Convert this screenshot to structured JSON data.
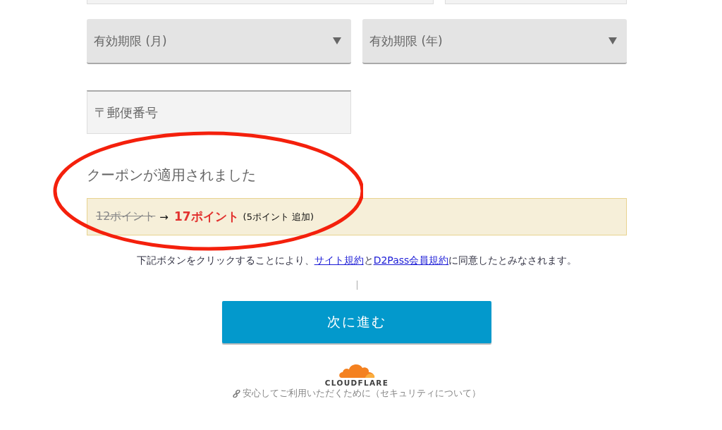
{
  "expiry_selects": [
    {
      "placeholder": "有効期限 (月)"
    },
    {
      "placeholder": "有効期限 (年)"
    }
  ],
  "postal_code": {
    "placeholder": "〒郵便番号"
  },
  "coupon": {
    "heading": "クーポンが適用されました",
    "old_points": "12ポイント",
    "arrow": "→",
    "new_points": "17ポイント",
    "bonus": "(5ポイント 追加)"
  },
  "terms": {
    "prefix": "下記ボタンをクリックすることにより、",
    "link_1": "サイト規約",
    "middle": "と",
    "link_2": "D2Pass会員規約",
    "suffix": "に同意したとみなされます。"
  },
  "next_button": "次に進む",
  "footer": {
    "brand": "CLOUDFLARE",
    "security_link": "安心してご利用いただくために（セキュリティについて）"
  }
}
